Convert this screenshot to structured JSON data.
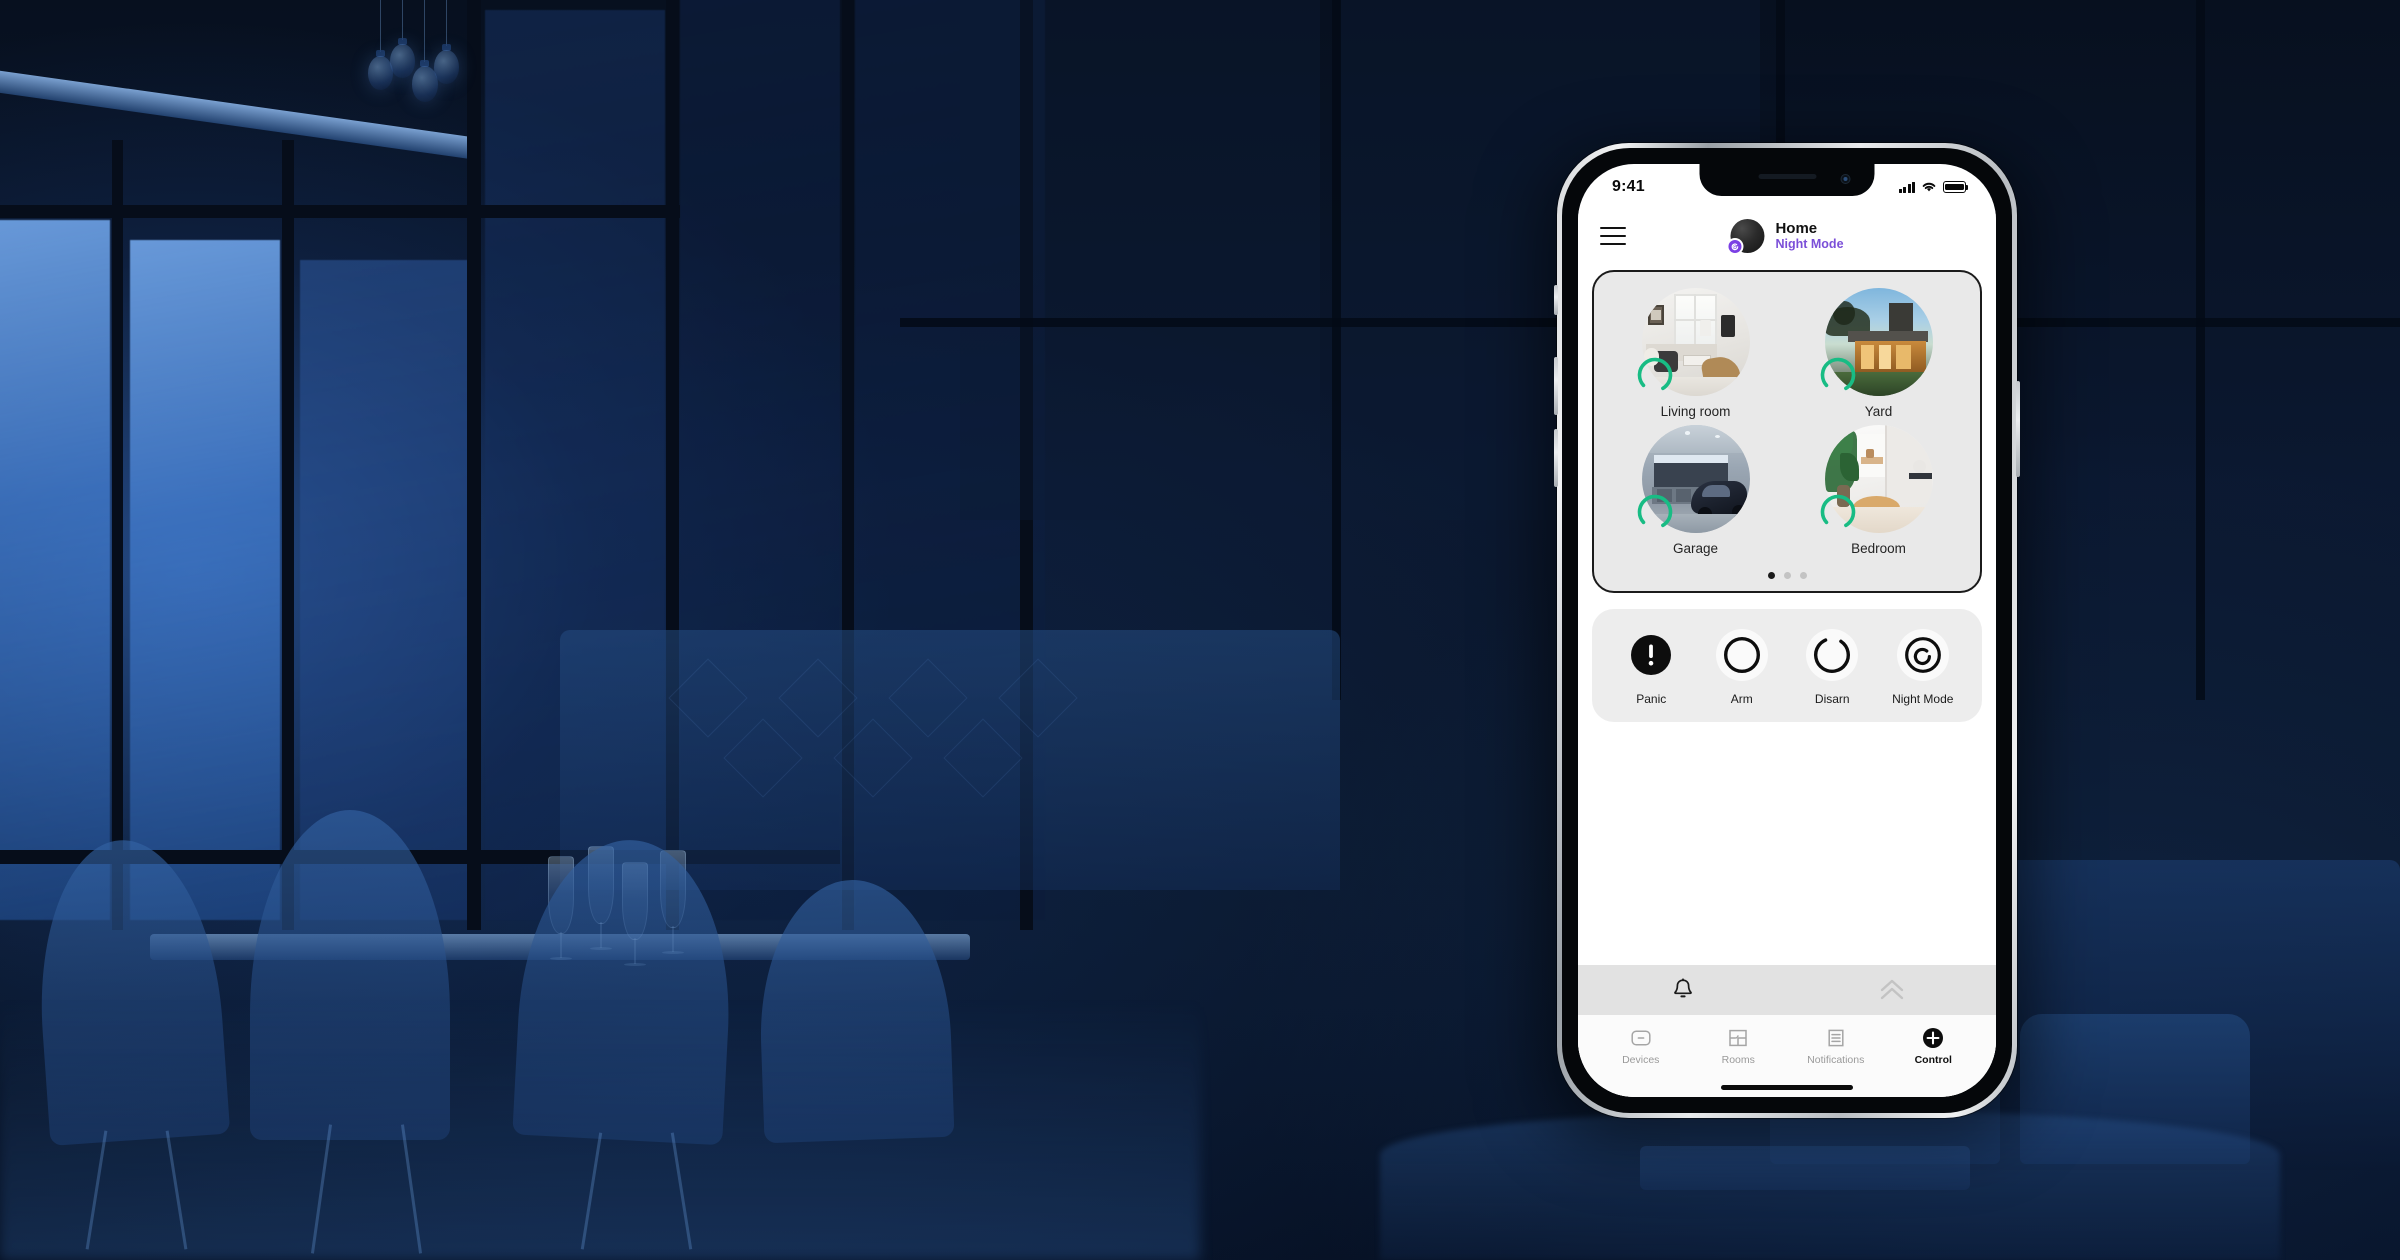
{
  "scene": {
    "description": "Dark blue night-time dining room interior with backlit windows",
    "ambient_color": "#0a1424",
    "window_light_color": "#4a82d7"
  },
  "phone": {
    "status_bar": {
      "time": "9:41",
      "signal_icon": "cellular-signal-icon",
      "wifi_icon": "wifi-icon",
      "battery_icon": "battery-full-icon"
    },
    "app_bar": {
      "menu_icon": "hamburger-menu-icon",
      "avatar_icon": "home-avatar",
      "badge_icon": "spiral-logo-icon",
      "title": "Home",
      "mode": "Night Mode",
      "mode_color": "#7b4fd8"
    },
    "rooms_panel": {
      "rooms": [
        {
          "label": "Living room",
          "status": "ok",
          "status_color": "#18bc84",
          "thumb": "living-room-photo"
        },
        {
          "label": "Yard",
          "status": "ok",
          "status_color": "#18bc84",
          "thumb": "yard-photo"
        },
        {
          "label": "Garage",
          "status": "ok",
          "status_color": "#18bc84",
          "thumb": "garage-photo"
        },
        {
          "label": "Bedroom",
          "status": "ok",
          "status_color": "#18bc84",
          "thumb": "bedroom-photo"
        }
      ],
      "pages": 3,
      "active_page": 1
    },
    "actions": [
      {
        "label": "Panic",
        "icon": "panic-exclamation-icon",
        "style": "filled"
      },
      {
        "label": "Arm",
        "icon": "arm-circle-icon",
        "style": "outline"
      },
      {
        "label": "Disarn",
        "icon": "disarm-open-circle-icon",
        "style": "outline"
      },
      {
        "label": "Night Mode",
        "icon": "night-mode-spiral-icon",
        "style": "outline"
      }
    ],
    "quick_row": [
      {
        "icon": "bell-icon",
        "state": "active"
      },
      {
        "icon": "chevron-double-up-icon",
        "state": "dim"
      }
    ],
    "tabs": [
      {
        "label": "Devices",
        "icon": "device-switch-icon",
        "active": false
      },
      {
        "label": "Rooms",
        "icon": "floorplan-icon",
        "active": false
      },
      {
        "label": "Notifications",
        "icon": "list-lines-icon",
        "active": false
      },
      {
        "label": "Control",
        "icon": "plus-circle-icon",
        "active": true
      }
    ]
  }
}
